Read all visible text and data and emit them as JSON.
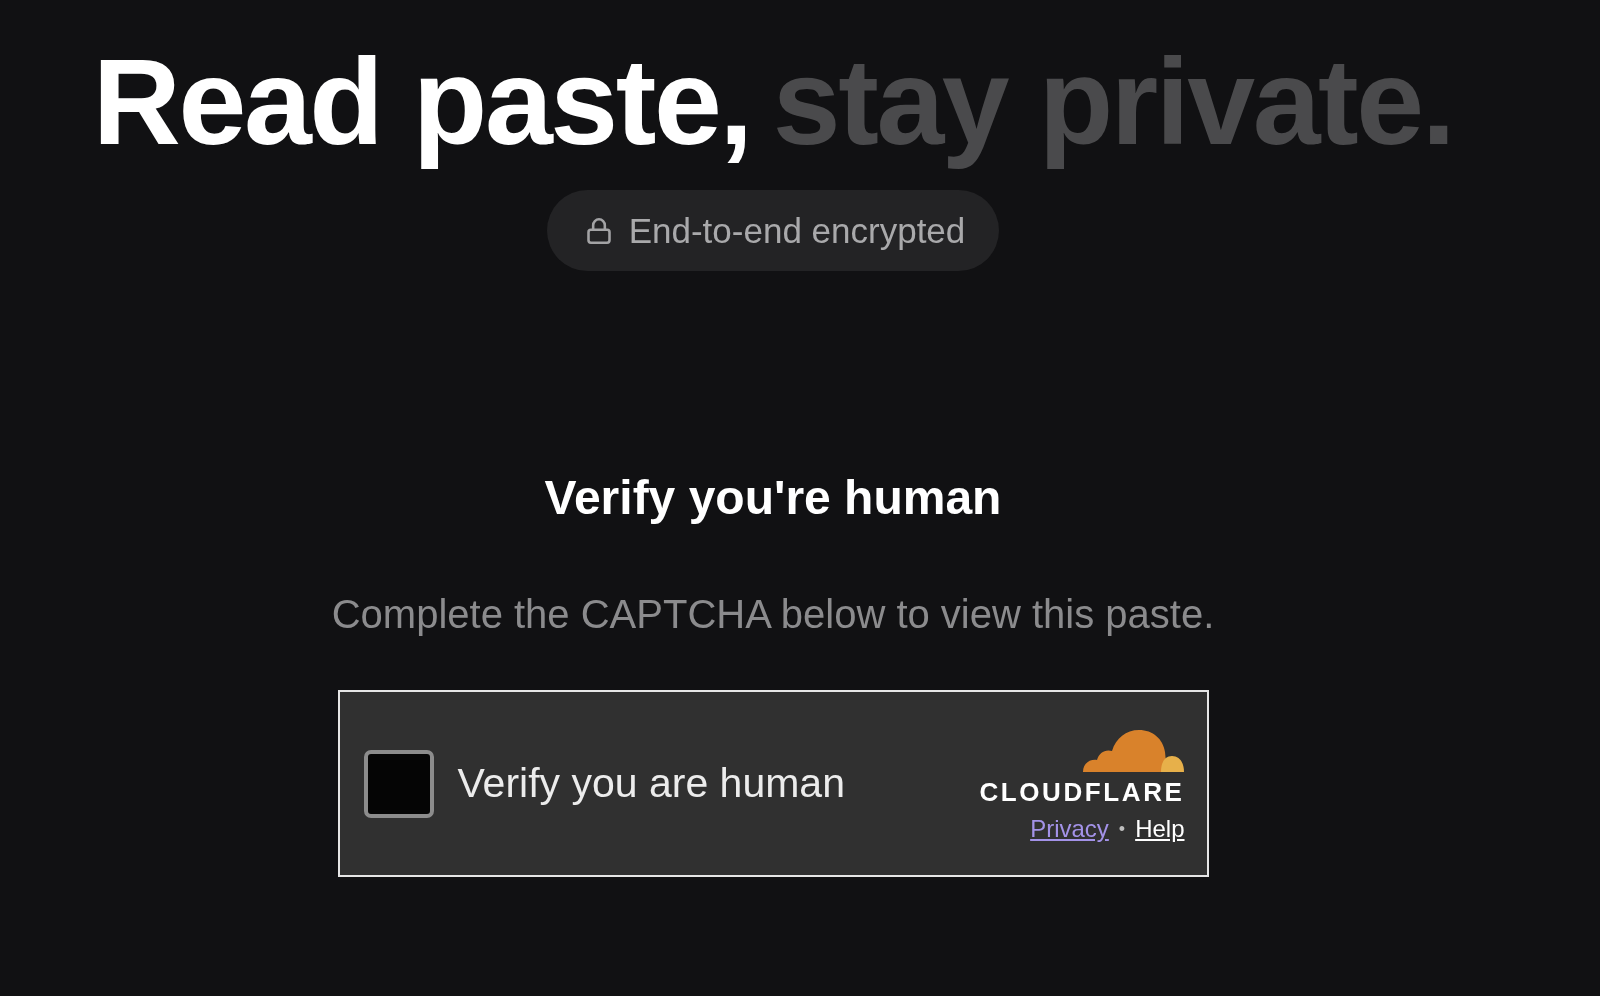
{
  "headline": {
    "lead": "Read paste,",
    "tail": "stay private."
  },
  "badge": {
    "label": "End-to-end encrypted"
  },
  "verify": {
    "title": "Verify you're human",
    "description": "Complete the CAPTCHA below to view this paste."
  },
  "captcha": {
    "checkbox": {
      "label": "Verify you are human",
      "checked": false
    },
    "brand": "CLOUDFLARE",
    "links": [
      {
        "label": "Privacy",
        "visited": true
      },
      {
        "label": "Help",
        "visited": false
      }
    ],
    "separator": "•"
  }
}
